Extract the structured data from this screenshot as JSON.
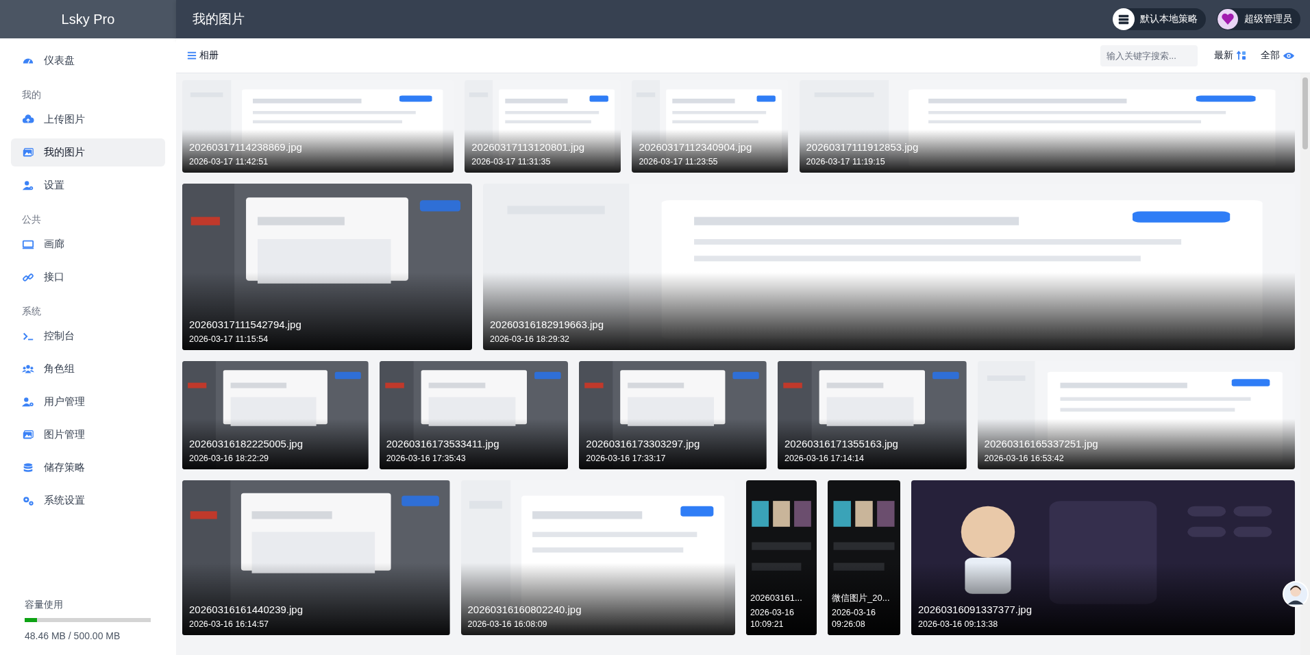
{
  "app": {
    "logo": "Lsky Pro"
  },
  "header": {
    "title": "我的图片",
    "strategy": "默认本地策略",
    "user": "超级管理员"
  },
  "sidebar": {
    "sections": [
      {
        "items": [
          {
            "label": "仪表盘",
            "selected": false
          }
        ]
      },
      {
        "heading": "我的",
        "items": [
          {
            "label": "上传图片",
            "selected": false
          },
          {
            "label": "我的图片",
            "selected": true
          },
          {
            "label": "设置",
            "selected": false
          }
        ]
      },
      {
        "heading": "公共",
        "items": [
          {
            "label": "画廊",
            "selected": false
          },
          {
            "label": "接口",
            "selected": false
          }
        ]
      },
      {
        "heading": "系统",
        "items": [
          {
            "label": "控制台",
            "selected": false
          },
          {
            "label": "角色组",
            "selected": false
          },
          {
            "label": "用户管理",
            "selected": false
          },
          {
            "label": "图片管理",
            "selected": false
          },
          {
            "label": "储存策略",
            "selected": false
          },
          {
            "label": "系统设置",
            "selected": false
          }
        ]
      }
    ],
    "storage": {
      "label": "容量使用",
      "level": 0.097,
      "reading": "48.46 MB / 500.00 MB"
    }
  },
  "toolbar": {
    "albums": "相册",
    "search": {
      "placeholder": "输入关键字搜索..."
    },
    "sort": "最新",
    "filter": "全部"
  },
  "gallery": {
    "rows": [
      {
        "images": [
          {
            "name": "20260317114238869.jpg",
            "time": "2026-03-17 11:42:51"
          },
          {
            "name": "20260317113120801.jpg",
            "time": "2026-03-17 11:31:35"
          },
          {
            "name": "20260317112340904.jpg",
            "time": "2026-03-17 11:23:55"
          },
          {
            "name": "20260317111912853.jpg",
            "time": "2026-03-17 11:19:15"
          }
        ]
      },
      {
        "images": [
          {
            "name": "20260317111542794.jpg",
            "time": "2026-03-17 11:15:54"
          },
          {
            "name": "20260316182919663.jpg",
            "time": "2026-03-16 18:29:32"
          }
        ]
      },
      {
        "images": [
          {
            "name": "20260316182225005.jpg",
            "time": "2026-03-16 18:22:29"
          },
          {
            "name": "20260316173533411.jpg",
            "time": "2026-03-16 17:35:43"
          },
          {
            "name": "20260316173303297.jpg",
            "time": "2026-03-16 17:33:17"
          },
          {
            "name": "20260316171355163.jpg",
            "time": "2026-03-16 17:14:14"
          },
          {
            "name": "20260316165337251.jpg",
            "time": "2026-03-16 16:53:42"
          }
        ]
      },
      {
        "images": [
          {
            "name": "20260316161440239.jpg",
            "time": "2026-03-16 16:14:57"
          },
          {
            "name": "20260316160802240.jpg",
            "time": "2026-03-16 16:08:09"
          },
          {
            "name": "202603161...",
            "time": "2026-03-16 10:09:21"
          },
          {
            "name": "微信图片_20...",
            "time": "2026-03-16 09:26:08"
          },
          {
            "name": "20260316091337377.jpg",
            "time": "2026-03-16 09:13:38"
          }
        ]
      }
    ]
  }
}
